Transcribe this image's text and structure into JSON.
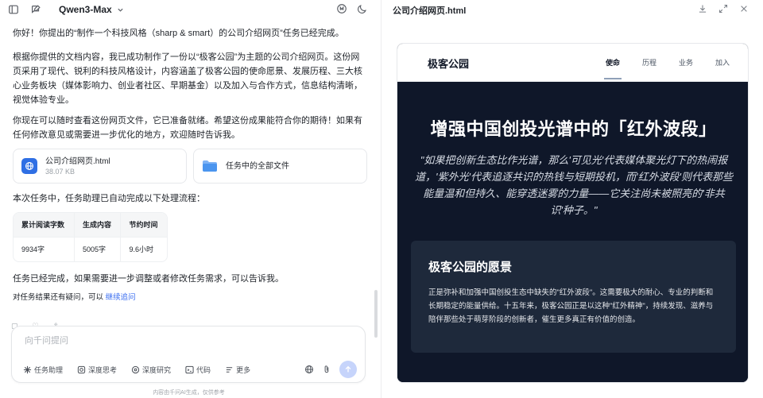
{
  "topbar": {
    "model_name": "Qwen3-Max"
  },
  "chat": {
    "paragraphs": {
      "p1": "你好！你提出的“制作一个科技风格（sharp & smart）的公司介绍网页”任务已经完成。",
      "p2": "根据你提供的文档内容，我已成功制作了一份以“极客公园”为主题的公司介绍网页。这份网页采用了现代、锐利的科技风格设计，内容涵盖了极客公园的使命愿景、发展历程、三大核心业务板块（媒体影响力、创业者社区、早期基金）以及加入与合作方式，信息结构清晰，视觉体验专业。",
      "p3": "你现在可以随时查看这份网页文件，它已准备就绪。希望这份成果能符合你的期待！如果有任何修改意见或需要进一步优化的地方，欢迎随时告诉我。",
      "p4": "本次任务中，任务助理已自动完成以下处理流程：",
      "p5": "任务已经完成，如果需要进一步调整或者修改任务需求，可以告诉我。"
    },
    "file_card": {
      "name": "公司介绍网页.html",
      "size": "38.07 KB"
    },
    "folder_card": {
      "label": "任务中的全部文件"
    },
    "stats_table": {
      "headers": [
        "累计阅读字数",
        "生成内容",
        "节约时间"
      ],
      "values": [
        "9934字",
        "5005字",
        "9.6小时"
      ]
    },
    "follow_up": {
      "prefix": "对任务结果还有疑问，可以",
      "link": "继续追问"
    }
  },
  "composer": {
    "placeholder": "向千问提问",
    "tools": [
      "任务助理",
      "深度思考",
      "深度研究",
      "代码",
      "更多"
    ]
  },
  "disclaimer": "内容由千问AI生成，仅供参考",
  "preview": {
    "file_title": "公司介绍网页.html",
    "site": {
      "brand": "极客公园",
      "nav": [
        "使命",
        "历程",
        "业务",
        "加入"
      ],
      "hero_title": "增强中国创投光谱中的「红外波段」",
      "hero_quote": "\"如果把创新生态比作光谱，那么'可见光'代表媒体聚光灯下的热闹报道，'紫外光'代表追逐共识的热钱与短期投机，而'红外波段'则代表那些能量温和但持久、能穿透迷雾的力量——它关注尚未被照亮的'非共识'种子。\"",
      "vision_title": "极客公园的愿景",
      "vision_text": "正是弥补和加强中国创投生态中缺失的\"红外波段\"。这需要极大的耐心、专业的判断和长期稳定的能量供给。十五年来，极客公园正是以这种\"红外精神\"，持续发现、滋养与陪伴那些处于萌芽阶段的创新者，催生更多真正有价值的创造。"
    }
  },
  "colors": {
    "accent": "#2f6fe4",
    "link": "#3b6ef0",
    "hero_bg": "#0f1729",
    "card_bg": "#1e293b"
  }
}
